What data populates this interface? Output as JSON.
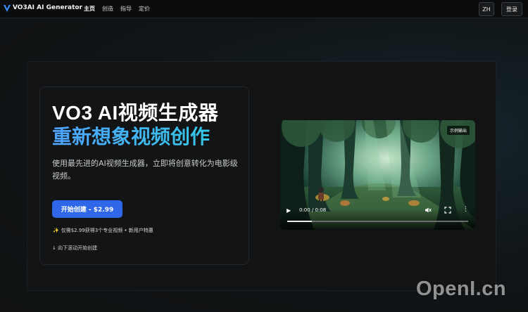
{
  "header": {
    "brand": "VO3AI AI Generator",
    "nav": [
      {
        "label": "主页",
        "active": true
      },
      {
        "label": "创造",
        "active": false
      },
      {
        "label": "指导",
        "active": false
      },
      {
        "label": "定价",
        "active": false
      }
    ],
    "lang_label": "ZH",
    "login_label": "登录",
    "logo_icon": "v-logo-icon"
  },
  "hero": {
    "title_line1": "VO3 AI视频生成器",
    "title_line2": "重新想象视频创作",
    "description": "使用最先进的AI视频生成器，立即将创意转化为电影级视频。",
    "cta_label": "开始创建 - $2.99",
    "promo_icon": "✨",
    "promo_text": "仅需$2.99获得3个专业视频 • 新用户特惠",
    "scroll_hint": "↓ 向下滚动开始创建"
  },
  "video": {
    "badge": "示例输出",
    "time": "0:00 / 0:08",
    "progress": 0.0,
    "icons": [
      "play-icon",
      "mute-icon",
      "fullscreen-icon",
      "more-icon"
    ]
  },
  "watermark": "OpenI.cn",
  "colors": {
    "accent": "#2f67e8",
    "gradient_start": "#4fa3ff",
    "gradient_end": "#34c6e6",
    "background": "#0f1112"
  }
}
